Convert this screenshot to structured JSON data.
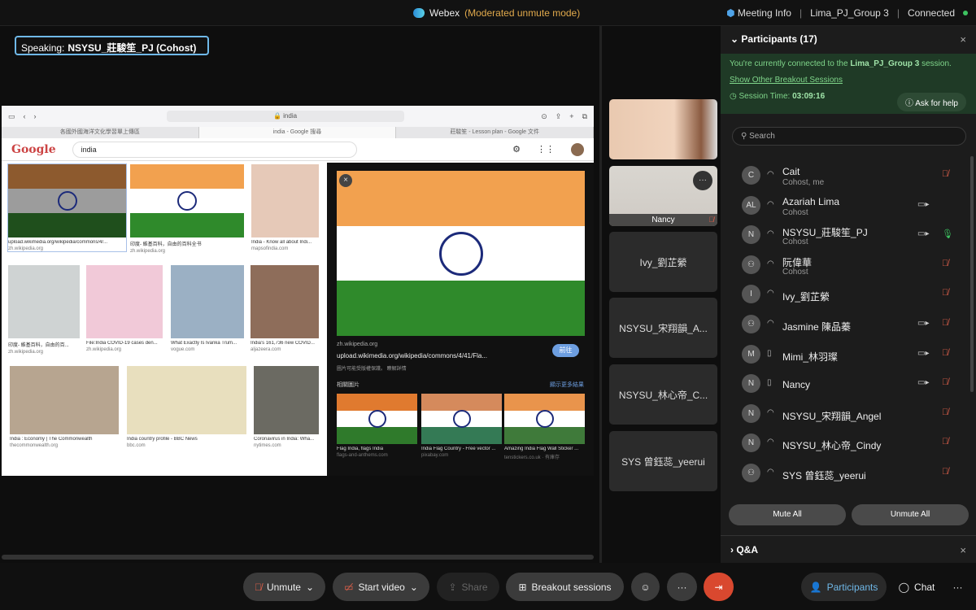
{
  "topbar": {
    "app": "Webex",
    "mode": "(Moderated unmute mode)",
    "meeting_info": "Meeting Info",
    "session": "Lima_PJ_Group 3",
    "status": "Connected"
  },
  "speaking": {
    "label": "Speaking:",
    "name": "NSYSU_莊駿笙_PJ (Cohost)"
  },
  "browser": {
    "url": "india",
    "tabs": [
      "各國外國海洋文化學習單上傳區",
      "india - Google 搜尋",
      "莊駿笙 - Lesson plan - Google 文件"
    ],
    "search_value": "india",
    "results": [
      {
        "caption": "upload.wikimedia.org/wikipedia/commons/4/...",
        "source": "zh.wikipedia.org"
      },
      {
        "caption": "印度- 維基百科，自由的百科全书",
        "source": "zh.wikipedia.org"
      },
      {
        "caption": "India - Know all about Indi...",
        "source": "mapsofindia.com"
      },
      {
        "caption": "印度- 維基百科，自由的百...",
        "source": "zh.wikipedia.org"
      },
      {
        "caption": "File:India COVID-19 cases den...",
        "source": "zh.wikipedia.org"
      },
      {
        "caption": "What Exactly Is Ivanka Trum...",
        "source": "vogue.com"
      },
      {
        "caption": "India's 161,736 new COVID...",
        "source": "aljazeera.com"
      },
      {
        "caption": "India : Economy | The Commonwealth",
        "source": "thecommonwealth.org"
      },
      {
        "caption": "India country profile - BBC News",
        "source": "bbc.com"
      },
      {
        "caption": "Coronavirus in India: Wha...",
        "source": "nytimes.com"
      }
    ],
    "preview": {
      "site": "zh.wikipedia.org",
      "title": "upload.wikimedia.org/wikipedia/commons/4/41/Fla...",
      "notice": "圖片可能受版權保護。 瞭解詳情",
      "go": "前往",
      "related": "相關圖片",
      "more": "顯示更多結果",
      "related_items": [
        {
          "caption": "Flag India, flags India",
          "source": "flags-and-anthems.com"
        },
        {
          "caption": "India Flag Country - Free vector ...",
          "source": "pixabay.com"
        },
        {
          "caption": "Amazing India Flag Wall Sticker ...",
          "source": "tenstickers.co.uk · 有庫存"
        }
      ]
    }
  },
  "thumbnails": [
    {
      "name": ""
    },
    {
      "name": "Nancy"
    },
    {
      "name": "Ivy_劉芷縈"
    },
    {
      "name": "NSYSU_宋翔韻_A..."
    },
    {
      "name": "NSYSU_林心帝_C..."
    },
    {
      "name": "SYS 曾鈺蕊_yeerui"
    }
  ],
  "panel": {
    "title": "Participants (17)",
    "banner_pre": "You're currently connected to the",
    "banner_session": "Lima_PJ_Group 3",
    "banner_post": "session.",
    "show_other": "Show Other Breakout Sessions",
    "session_time_label": "Session Time:",
    "session_time": "03:09:16",
    "ask_help": "Ask for help",
    "search_placeholder": "Search",
    "participants": [
      {
        "initials": "C",
        "name": "Cait",
        "role": "Cohost, me",
        "device": "headset",
        "video": false,
        "mic": "muted"
      },
      {
        "initials": "AL",
        "name": "Azariah Lima",
        "role": "Cohost",
        "device": "headset",
        "video": true,
        "mic": "none"
      },
      {
        "initials": "N",
        "name": "NSYSU_莊駿笙_PJ",
        "role": "Cohost",
        "device": "headset",
        "video": true,
        "mic": "active"
      },
      {
        "initials": "",
        "name": "阮偉華",
        "role": "Cohost",
        "device": "headset",
        "video": false,
        "mic": "muted"
      },
      {
        "initials": "I",
        "name": "Ivy_劉芷縈",
        "role": "",
        "device": "headset",
        "video": false,
        "mic": "muted"
      },
      {
        "initials": "",
        "name": "Jasmine 陳品蓁",
        "role": "",
        "device": "headset",
        "video": true,
        "mic": "muted"
      },
      {
        "initials": "M",
        "name": "Mimi_林羽璨",
        "role": "",
        "device": "phone",
        "video": true,
        "mic": "muted"
      },
      {
        "initials": "N",
        "name": "Nancy",
        "role": "",
        "device": "phone",
        "video": true,
        "mic": "muted"
      },
      {
        "initials": "N",
        "name": "NSYSU_宋翔韻_Angel",
        "role": "",
        "device": "headset",
        "video": false,
        "mic": "muted"
      },
      {
        "initials": "N",
        "name": "NSYSU_林心帝_Cindy",
        "role": "",
        "device": "headset",
        "video": false,
        "mic": "muted"
      },
      {
        "initials": "",
        "name": "SYS 曾鈺蕊_yeerui",
        "role": "",
        "device": "headset",
        "video": false,
        "mic": "muted"
      }
    ],
    "mute_all": "Mute All",
    "unmute_all": "Unmute All",
    "qa": "Q&A"
  },
  "bottom": {
    "unmute": "Unmute",
    "start_video": "Start video",
    "share": "Share",
    "breakout": "Breakout sessions",
    "participants": "Participants",
    "chat": "Chat"
  },
  "colors": {
    "accent": "#6fb8e8",
    "muted": "#e0604a",
    "active_mic": "#3dc260",
    "banner": "#1f3a26",
    "leave": "#d9482f"
  }
}
